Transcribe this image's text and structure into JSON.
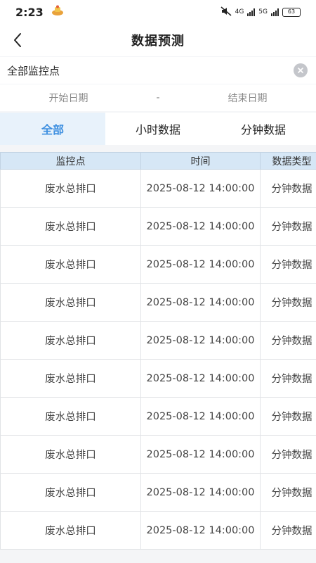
{
  "status_bar": {
    "time": "2:23",
    "network_4g": "4G",
    "network_5g": "5G",
    "battery": "63"
  },
  "header": {
    "title": "数据预测"
  },
  "search": {
    "value": "全部监控点",
    "placeholder": ""
  },
  "date_range": {
    "start_placeholder": "开始日期",
    "separator": "-",
    "end_placeholder": "结束日期"
  },
  "tabs": [
    {
      "label": "全部",
      "active": true
    },
    {
      "label": "小时数据",
      "active": false
    },
    {
      "label": "分钟数据",
      "active": false
    }
  ],
  "table": {
    "columns": [
      "监控点",
      "时间",
      "数据类型"
    ],
    "rows": [
      [
        "废水总排口",
        "2025-08-12 14:00:00",
        "分钟数据"
      ],
      [
        "废水总排口",
        "2025-08-12 14:00:00",
        "分钟数据"
      ],
      [
        "废水总排口",
        "2025-08-12 14:00:00",
        "分钟数据"
      ],
      [
        "废水总排口",
        "2025-08-12 14:00:00",
        "分钟数据"
      ],
      [
        "废水总排口",
        "2025-08-12 14:00:00",
        "分钟数据"
      ],
      [
        "废水总排口",
        "2025-08-12 14:00:00",
        "分钟数据"
      ],
      [
        "废水总排口",
        "2025-08-12 14:00:00",
        "分钟数据"
      ],
      [
        "废水总排口",
        "2025-08-12 14:00:00",
        "分钟数据"
      ],
      [
        "废水总排口",
        "2025-08-12 14:00:00",
        "分钟数据"
      ],
      [
        "废水总排口",
        "2025-08-12 14:00:00",
        "分钟数据"
      ]
    ]
  },
  "colors": {
    "accent": "#3d8fe0",
    "active_tab_bg": "#e8f2fb",
    "table_header_bg": "#d6e7f6",
    "page_bg": "#f4f5f7"
  }
}
